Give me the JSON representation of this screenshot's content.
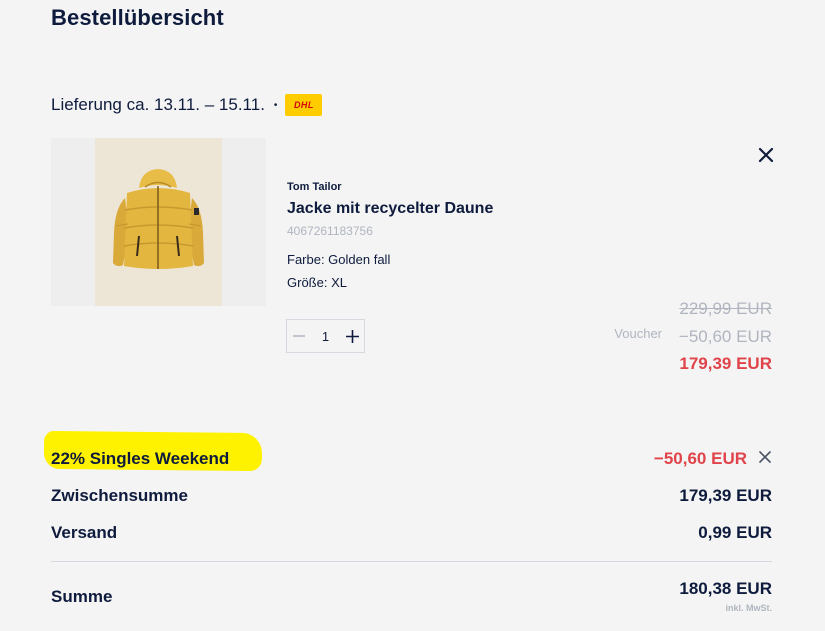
{
  "header": {
    "title": "Bestellübersicht"
  },
  "delivery": {
    "text": "Lieferung ca. 13.11. – 15.11.",
    "separator": "•",
    "carrier": "DHL",
    "carrier_color": "#ffcc00"
  },
  "product": {
    "image_icon": "yellow-jacket-image",
    "brand": "Tom Tailor",
    "name": "Jacke mit recycelter Daune",
    "ean": "4067261183756",
    "color": "Farbe: Golden fall",
    "size": "Größe: XL",
    "quantity": "1",
    "price_original": "229,99 EUR",
    "voucher_label": "Voucher",
    "voucher_value": "−50,60 EUR",
    "price_final": "179,39 EUR"
  },
  "summary": {
    "promo_label": "22% Singles Weekend",
    "promo_value": "−50,60 EUR",
    "subtotal_label": "Zwischensumme",
    "subtotal_value": "179,39 EUR",
    "shipping_label": "Versand",
    "shipping_value": "0,99 EUR",
    "total_label": "Summe",
    "total_value": "180,38 EUR",
    "tax_note": "inkl. MwSt."
  },
  "colors": {
    "accent_red": "#e0444a",
    "text_dark": "#0e1b3d",
    "muted": "#b0b5c0",
    "highlight": "#fff200"
  }
}
